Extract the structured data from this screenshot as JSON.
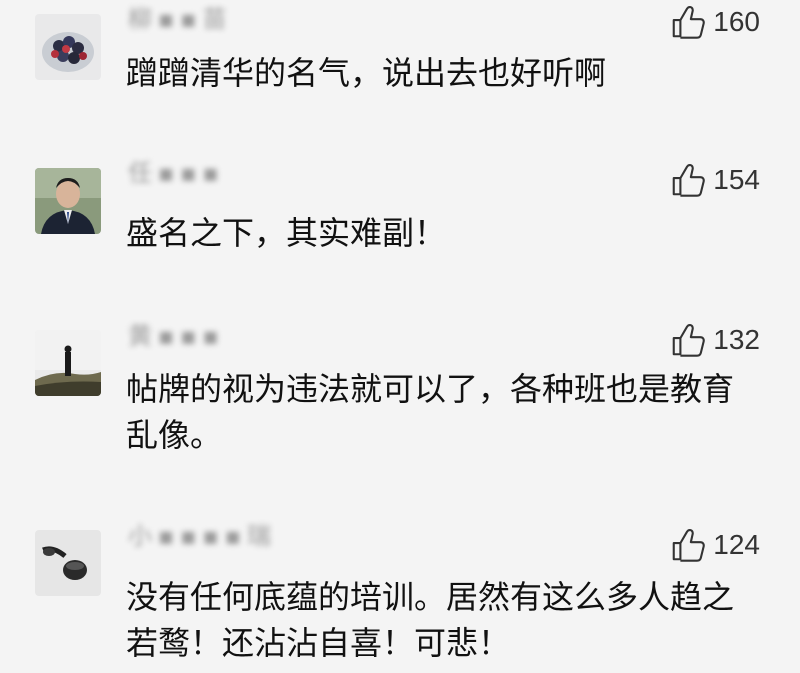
{
  "comments": [
    {
      "username": "柳▪▪苗",
      "avatar": "berries-photo-icon",
      "likes": "160",
      "text": "蹭蹭清华的名气，说出去也好听啊"
    },
    {
      "username": "任▪▪▪",
      "avatar": "man-portrait-photo-icon",
      "likes": "154",
      "text": "盛名之下，其实难副！"
    },
    {
      "username": "黄▪▪▪",
      "avatar": "person-on-hill-photo-icon",
      "likes": "132",
      "text": "帖牌的视为违法就可以了，各种班也是教育乱像。"
    },
    {
      "username": "小▪▪▪▪瑞",
      "avatar": "pipe-photo-icon",
      "likes": "124",
      "text": "没有任何底蕴的培训。居然有这么多人趋之若鹜！还沾沾自喜！可悲！"
    }
  ],
  "colors": {
    "background": "#f4f4f4",
    "text": "#111111",
    "meta": "#9a9a9a"
  },
  "icons": {
    "like": "thumbs-up-icon"
  }
}
